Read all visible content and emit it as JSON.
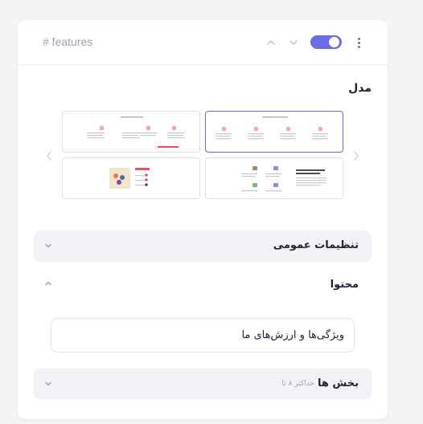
{
  "header": {
    "section_id": "# features"
  },
  "model": {
    "label": "مدل"
  },
  "accordions": {
    "general": {
      "title": "تنظیمات عمومی"
    },
    "content": {
      "title": "محتوا",
      "title_input_value": "ویژگی‌ها و ارزش‌های ما"
    },
    "sections": {
      "title": "بخش ها",
      "hint": "حداکثر ۸ تا"
    }
  },
  "colors": {
    "accent": "#6b6de6",
    "thumb_accent": "#e8505b"
  },
  "icons": [
    "chevron-up-icon",
    "chevron-down-icon",
    "kebab-menu-icon",
    "chevron-left-icon",
    "chevron-right-icon"
  ]
}
